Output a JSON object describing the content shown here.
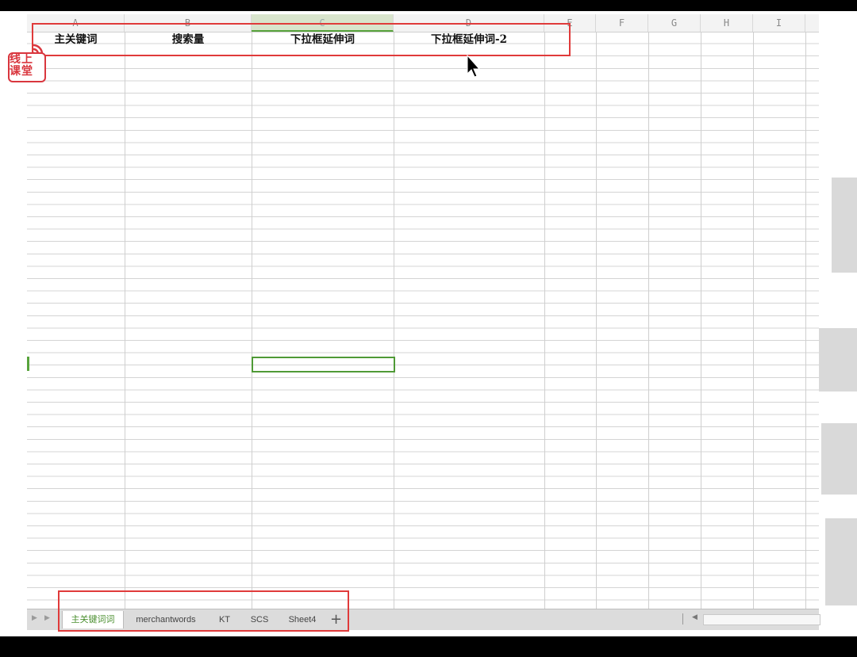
{
  "colors": {
    "accent_green": "#58a33c",
    "annotation_red": "#e03a3a",
    "logo_red": "#d9363e"
  },
  "columns": [
    {
      "letter": "A"
    },
    {
      "letter": "B"
    },
    {
      "letter": "C"
    },
    {
      "letter": "D"
    },
    {
      "letter": "E"
    },
    {
      "letter": "F"
    },
    {
      "letter": "G"
    },
    {
      "letter": "H"
    },
    {
      "letter": "I"
    }
  ],
  "header_row": {
    "a": "主关键词",
    "b": "搜索量",
    "c": "下拉框延伸词",
    "d": "下拉框延伸词-2"
  },
  "sheet_tabs": [
    "主关键词词",
    "merchantwords",
    "KT",
    "SCS",
    "Sheet4"
  ],
  "add_tab_label": "+",
  "logo": {
    "text": "线上课堂",
    "icon": "broadcast-signal-icon"
  }
}
